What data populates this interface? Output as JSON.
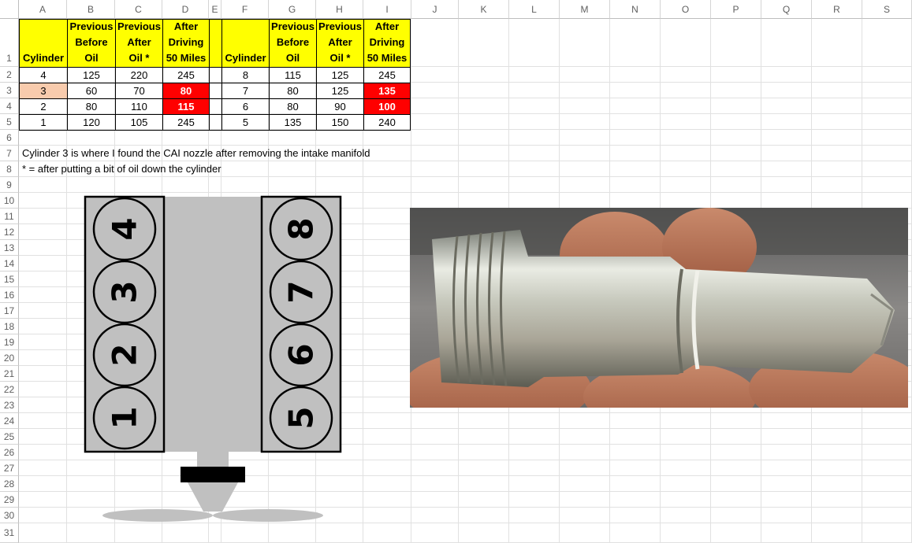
{
  "columns": [
    "A",
    "B",
    "C",
    "D",
    "E",
    "F",
    "G",
    "H",
    "I",
    "J",
    "K",
    "L",
    "M",
    "N",
    "O",
    "P",
    "Q",
    "R",
    "S"
  ],
  "rows": [
    "1",
    "2",
    "3",
    "4",
    "5",
    "6",
    "7",
    "8",
    "9",
    "10",
    "11",
    "12",
    "13",
    "14",
    "15",
    "16",
    "17",
    "18",
    "19",
    "20",
    "21",
    "22",
    "23",
    "24",
    "25",
    "26",
    "27",
    "28",
    "29",
    "30",
    "31"
  ],
  "table": {
    "headers": {
      "cylinder": "Cylinder",
      "previous_before": [
        "Previous",
        "Before",
        "Oil"
      ],
      "previous_after": [
        "Previous",
        "After",
        "Oil *"
      ],
      "after_driving": [
        "After",
        "Driving",
        "50 Miles"
      ]
    },
    "left_rows": [
      {
        "cyl": "4",
        "before": "125",
        "after": "220",
        "driving": "245"
      },
      {
        "cyl": "3",
        "before": "60",
        "after": "70",
        "driving": "80"
      },
      {
        "cyl": "2",
        "before": "80",
        "after": "110",
        "driving": "115"
      },
      {
        "cyl": "1",
        "before": "120",
        "after": "105",
        "driving": "245"
      }
    ],
    "right_rows": [
      {
        "cyl": "8",
        "before": "115",
        "after": "125",
        "driving": "245"
      },
      {
        "cyl": "7",
        "before": "80",
        "after": "125",
        "driving": "135"
      },
      {
        "cyl": "6",
        "before": "80",
        "after": "90",
        "driving": "100"
      },
      {
        "cyl": "5",
        "before": "135",
        "after": "150",
        "driving": "240"
      }
    ]
  },
  "notes": {
    "row7": "Cylinder 3 is where I found the CAI nozzle after removing the intake manifold",
    "row8": "* = after putting a bit of oil down the cylinder"
  },
  "engine_diagram": {
    "left_bank": [
      "4",
      "3",
      "2",
      "1"
    ],
    "right_bank": [
      "8",
      "7",
      "6",
      "5"
    ]
  },
  "colors": {
    "header_fill": "#ffff00",
    "low_value_fill": "#ff0000",
    "highlight_cylinder_fill": "#f8cbad"
  }
}
